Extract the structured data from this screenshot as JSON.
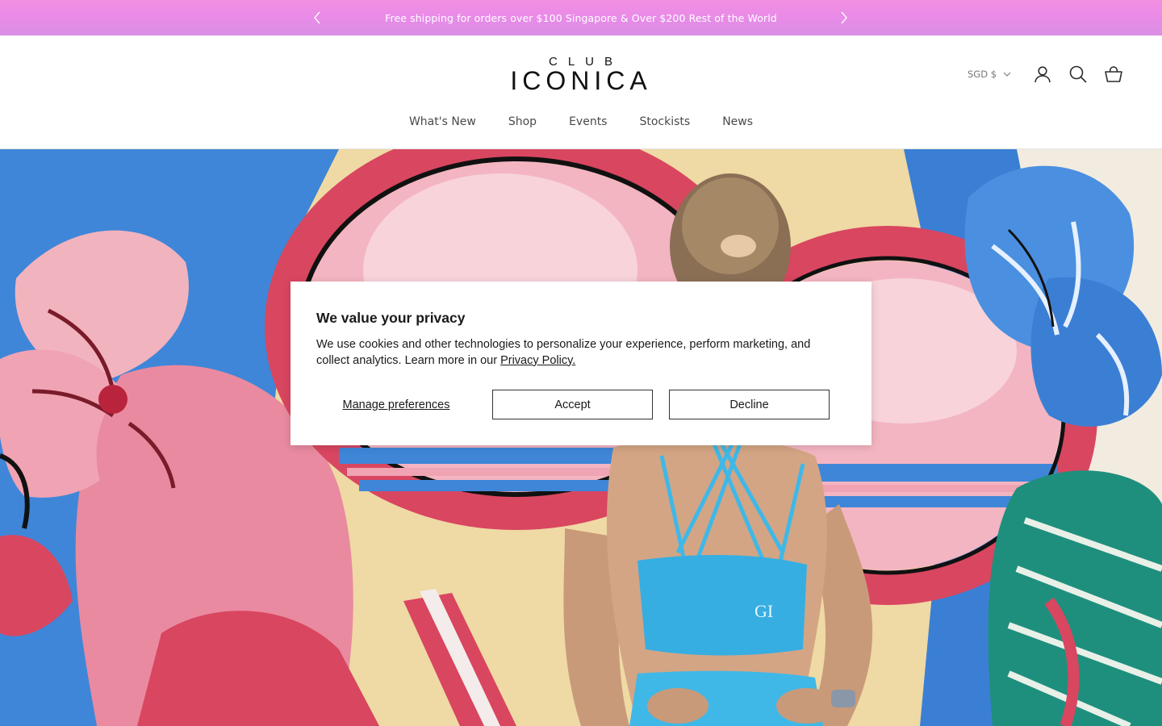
{
  "announcement": {
    "text": "Free shipping for orders over $100 Singapore & Over $200 Rest of the World",
    "prev_icon": "chevron-left-icon",
    "next_icon": "chevron-right-icon",
    "background": "#ea8be8"
  },
  "header": {
    "logo_top": "CLUB",
    "logo_main": "ICONICA",
    "currency": "SGD $",
    "icons": [
      "user-icon",
      "search-icon",
      "cart-icon"
    ]
  },
  "nav": {
    "items": [
      {
        "label": "What's New"
      },
      {
        "label": "Shop"
      },
      {
        "label": "Events"
      },
      {
        "label": "Stockists"
      },
      {
        "label": "News"
      }
    ]
  },
  "cookie": {
    "title": "We value your privacy",
    "body": "We use cookies and other technologies to personalize your experience, perform marketing, and collect analytics. Learn more in our ",
    "link": "Privacy Policy.",
    "manage": "Manage preferences",
    "accept": "Accept",
    "decline": "Decline"
  },
  "hero": {
    "image": "Woman in light blue sports bra in front of colorful painted mural",
    "accent": "#3fb8e8"
  }
}
